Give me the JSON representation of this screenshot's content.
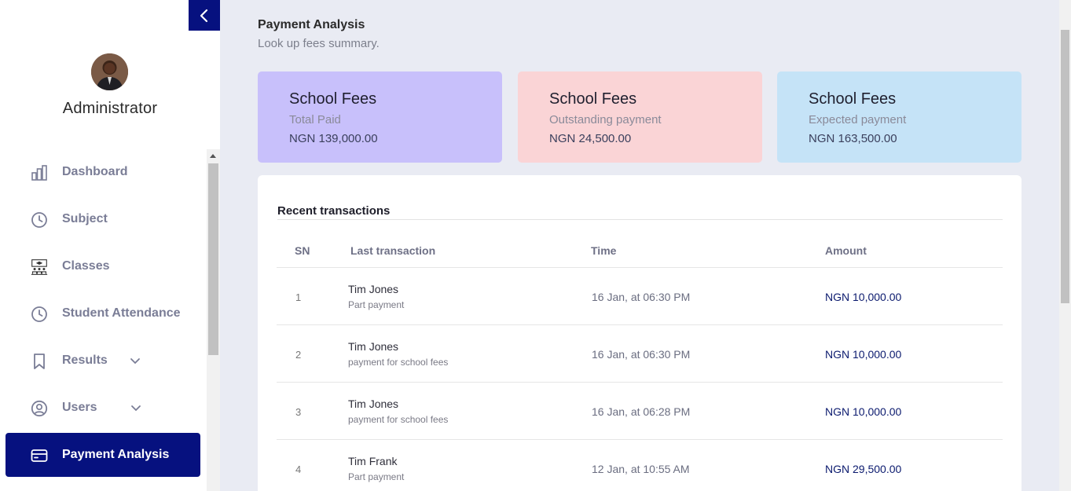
{
  "sidebar": {
    "user_name": "Administrator",
    "items": [
      {
        "label": "Dashboard",
        "icon": "bar-chart-icon"
      },
      {
        "label": "Subject",
        "icon": "clock-icon"
      },
      {
        "label": "Classes",
        "icon": "classroom-icon"
      },
      {
        "label": "Student Attendance",
        "icon": "clock-icon"
      },
      {
        "label": "Results",
        "icon": "bookmark-icon"
      },
      {
        "label": "Users",
        "icon": "user-circle-icon"
      },
      {
        "label": "Payment Analysis",
        "icon": "credit-card-icon"
      }
    ],
    "active_item": "Payment Analysis"
  },
  "header": {
    "title": "Payment Analysis",
    "subtitle": "Look up fees summary."
  },
  "cards": [
    {
      "title": "School Fees",
      "subtitle": "Total Paid",
      "amount": "NGN 139,000.00",
      "color": "#c8c0fb"
    },
    {
      "title": "School Fees",
      "subtitle": "Outstanding payment",
      "amount": "NGN 24,500.00",
      "color": "#fad4d6"
    },
    {
      "title": "School Fees",
      "subtitle": "Expected payment",
      "amount": "NGN 163,500.00",
      "color": "#c5e3f7"
    }
  ],
  "transactions": {
    "title": "Recent transactions",
    "columns": [
      "SN",
      "Last transaction",
      "Time",
      "Amount"
    ],
    "rows": [
      {
        "sn": "1",
        "name": "Tim Jones",
        "desc": "Part payment",
        "time": "16 Jan, at 06:30 PM",
        "amount": "NGN 10,000.00"
      },
      {
        "sn": "2",
        "name": "Tim Jones",
        "desc": "payment for school fees",
        "time": "16 Jan, at 06:30 PM",
        "amount": "NGN 10,000.00"
      },
      {
        "sn": "3",
        "name": "Tim Jones",
        "desc": "payment for school fees",
        "time": "16 Jan, at 06:28 PM",
        "amount": "NGN 10,000.00"
      },
      {
        "sn": "4",
        "name": "Tim Frank",
        "desc": "Part payment",
        "time": "12 Jan, at 10:55 AM",
        "amount": "NGN 29,500.00"
      }
    ]
  },
  "colors": {
    "accent": "#06117f",
    "amount_text": "#0b1a6e"
  }
}
